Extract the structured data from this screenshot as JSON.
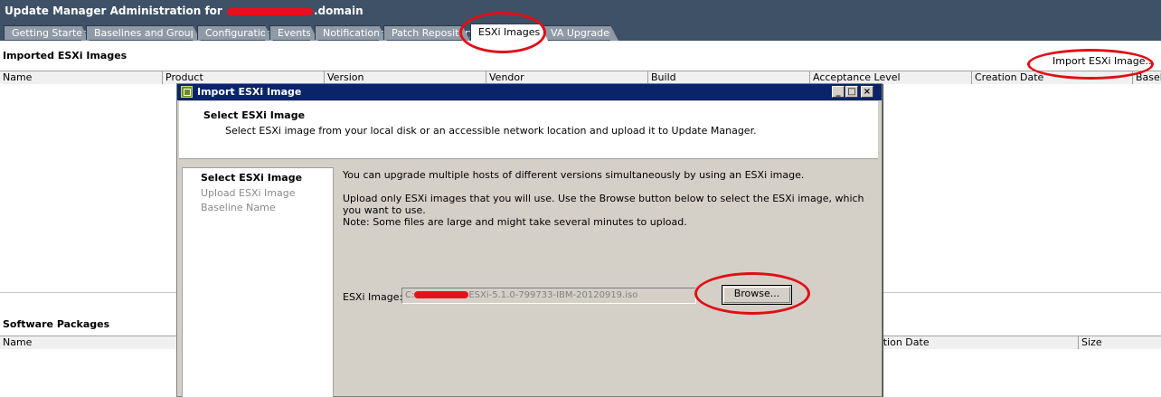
{
  "window": {
    "title_prefix": "Update Manager Administration for ",
    "title_suffix": ".domain"
  },
  "tabs": [
    {
      "label": "Getting Started"
    },
    {
      "label": "Baselines and Groups"
    },
    {
      "label": "Configuration"
    },
    {
      "label": "Events"
    },
    {
      "label": "Notifications"
    },
    {
      "label": "Patch Repository"
    },
    {
      "label": "ESXi Images"
    },
    {
      "label": "VA Upgrades"
    }
  ],
  "active_tab": "ESXi Images",
  "imported_section": {
    "title": "Imported ESXi Images",
    "import_button": "Import ESXi Image...",
    "columns": [
      "Name",
      "Product",
      "Version",
      "Vendor",
      "Build",
      "Acceptance Level",
      "Creation Date",
      "Baselines"
    ]
  },
  "software_section": {
    "title": "Software Packages",
    "columns": [
      "Name",
      "ation Date",
      "Size"
    ]
  },
  "dialog": {
    "title": "Import ESXi Image",
    "header_title": "Select ESXi Image",
    "header_subtitle": "Select ESXi image from your local disk or an accessible network location and upload it to Update Manager.",
    "steps": [
      {
        "label": "Select ESXi Image",
        "active": true
      },
      {
        "label": "Upload ESXi Image",
        "active": false
      },
      {
        "label": "Baseline Name",
        "active": false
      }
    ],
    "description": [
      "You can upgrade multiple hosts of different versions simultaneously by using an ESXi image.",
      "Upload only ESXi images that you will use. Use the Browse button below to select the ESXi image, which you want to use.",
      "Note: Some files are large and might take several minutes to upload."
    ],
    "field_label": "ESXi Image:",
    "field_value_prefix": "C:",
    "field_value_suffix": "ESXi-5.1.0-799733-IBM-20120919.iso",
    "browse_button": "Browse...",
    "window_buttons": [
      "_",
      "□",
      "×"
    ]
  },
  "colors": {
    "titlebar": "#3e5166",
    "annotation": "#e20e16",
    "redaction": "#e8101c",
    "dialog_titlebar": "#0a246a"
  }
}
